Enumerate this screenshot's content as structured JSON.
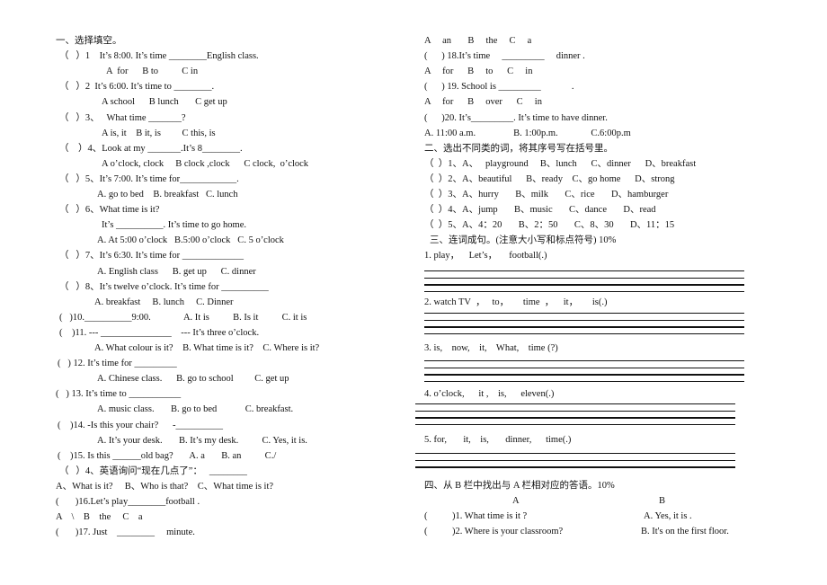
{
  "left_column": [
    "一、选择填空。",
    "（   ）1    It’s 8:00. It’s time ________English class.",
    "A  for      B to          C in",
    "（   ）2  It’s 6:00. It’s time to ________.",
    "A school      B lunch       C get up",
    "（   ）3、   What time _______?",
    "A is, it    B it, is         C this, is",
    "（    ）4、Look at my _______.It’s 8________.",
    "A o’clock, clock     B clock ,clock      C clock,  o’clock",
    "（   ）5、It’s 7:00. It’s time for____________.",
    "A. go to bed    B. breakfast   C. lunch",
    "（   ）6、What time is it?",
    "It’s __________. It’s time to go home.",
    "A. At 5:00 o’clock   B.5:00 o’clock   C. 5 o’clock",
    "（   ）7、It’s 6:30. It’s time for _____________",
    "A. English class      B. get up      C. dinner",
    "（   ）8、It’s twelve o’clock. It’s time for __________",
    "A. breakfast     B. lunch     C. Dinner",
    "(   )10.__________9:00.              A. It is          B. Is it          C. it is",
    "(    )11. --- _______________    --- It’s three o’clock.",
    "A. What colour is it?    B. What time is it?    C. Where is it?",
    "(   ) 12. It’s time for _________",
    "A. Chinese class.      B. go to school         C. get up",
    "(   ) 13. It’s time to ___________",
    "A. music class.       B. go to bed            C. breakfast.",
    "(    )14. -Is this your chair?      -__________",
    "A. It’s your desk.       B. It’s my desk.          C. Yes, it is.",
    "(    )15. Is this ______old bag?       A. a       B. an          C./",
    "（   ）4、英语询问“现在几点了”：   ________",
    "A、What is it?     B、Who is that?    C、What time is it?",
    "(       )16.Let’s play________football .",
    "A    \\    B    the     C    a",
    "(       )17. Just    ________     minute."
  ],
  "right_column": [
    "A     an       B     the     C     a",
    "(      ) 18.It’s time     _________     dinner .",
    "A     for      B     to      C     in",
    "(      ) 19. School is _________             .",
    "A     for      B     over      C     in",
    "(      )20. It’s_________. It’s time to have dinner.",
    "A. 11:00 a.m.                B. 1:00p.m.              C.6:00p.m",
    "二、选出不同类的词，将其序号写在括号里。",
    "（  ）1、A、   playground     B、lunch      C、dinner      D、breakfast",
    "（  ）2、A、beautiful      B、ready    C、go home      D、strong",
    "（  ）3、A、hurry       B、milk       C、rice       D、hamburger",
    "（  ）4、A、jump       B、music       C、dance       D、read",
    "（  ）5、A、4：20       B、2：50       C、8、30       D、11：15"
  ],
  "section3": {
    "title": "三、连词成句。(注意大小写和标点符号) 10%",
    "items": [
      "1. play，    Let’s，     football(.)",
      "2. watch TV  ，   to，      time  ，    it，      is(.)",
      "3. is,    now,    it,    What,    time (?)",
      "4. o’clock,      it ,    is,      eleven(.)",
      "5. for,       it,    is,       dinner,      time(.)"
    ]
  },
  "section4": {
    "title": "四、从 B 栏中找出与 A 栏相对应的答语。10%",
    "col_a": "A",
    "col_b": "B",
    "rows": [
      {
        "bracket": "(",
        "question": ")1. What time is it ?",
        "answer": "A. Yes, it is ."
      },
      {
        "bracket": "(",
        "question": ")2. Where is your classroom?",
        "answer": "B. It's on the first floor."
      }
    ]
  }
}
